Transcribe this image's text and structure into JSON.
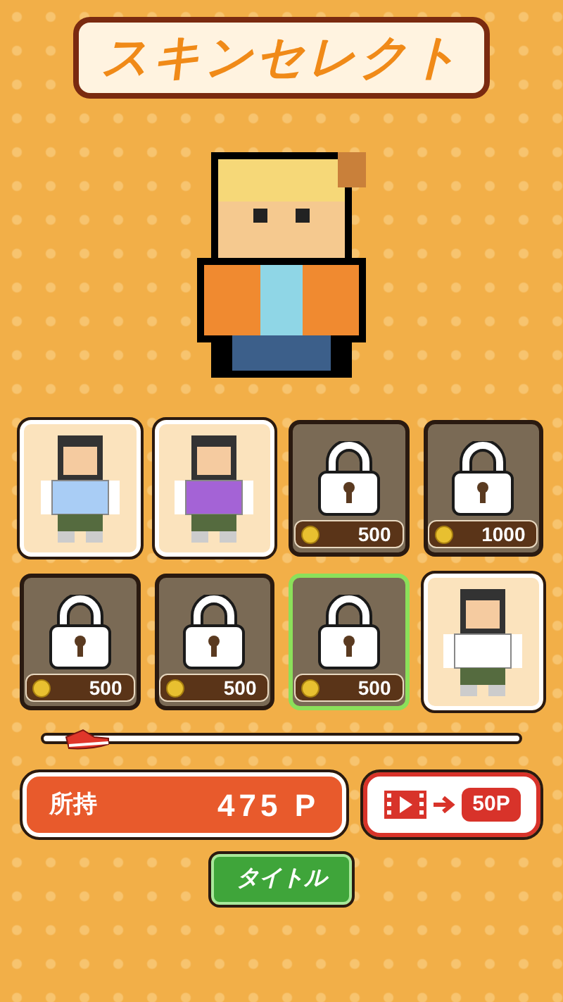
{
  "title": "スキンセレクト",
  "skins": [
    {
      "kind": "unlocked",
      "selected": false,
      "color": "#a9cdf5"
    },
    {
      "kind": "unlocked",
      "selected": false,
      "color": "#a463d6"
    },
    {
      "kind": "locked",
      "selected": false,
      "price": "500"
    },
    {
      "kind": "locked",
      "selected": false,
      "price": "1000"
    },
    {
      "kind": "locked",
      "selected": false,
      "price": "500"
    },
    {
      "kind": "locked",
      "selected": false,
      "price": "500"
    },
    {
      "kind": "locked",
      "selected": true,
      "price": "500"
    },
    {
      "kind": "unlocked",
      "selected": false,
      "color": "#ffffff"
    }
  ],
  "slider": {
    "level": 0.04
  },
  "owned": {
    "label": "所持",
    "value": "475 P"
  },
  "video_reward": {
    "reward": "50P"
  },
  "title_button": "タイトル"
}
